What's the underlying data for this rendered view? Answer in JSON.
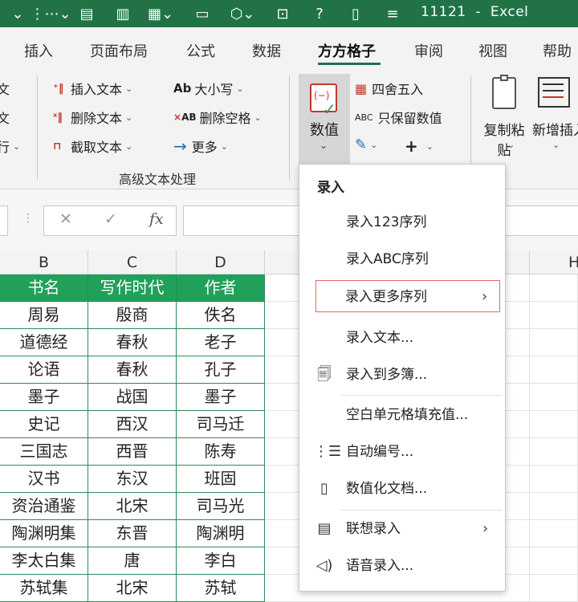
{
  "titlebar": {
    "doc_name": "11121",
    "separator": "-",
    "app_name": "Excel",
    "quick_access_icons": [
      "list-dropdown-icon",
      "form-icon",
      "chart-icon",
      "grid-icon",
      "screen-icon",
      "shapes-icon",
      "textbox-icon",
      "help-icon",
      "document-icon",
      "customize-icon"
    ]
  },
  "tabs": [
    {
      "label": "插入"
    },
    {
      "label": "页面布局"
    },
    {
      "label": "公式"
    },
    {
      "label": "数据"
    },
    {
      "label": "方方格子",
      "active": true
    },
    {
      "label": "审阅"
    },
    {
      "label": "视图"
    },
    {
      "label": "帮助"
    }
  ],
  "ribbon": {
    "left_partial": [
      "文",
      "文",
      "行"
    ],
    "text_group": {
      "insert_text": "插入文本",
      "delete_text": "删除文本",
      "extract_text": "截取文本",
      "case": "大小写",
      "case_icon": "Ab",
      "remove_spaces": "删除空格",
      "remove_spaces_icon": "AB",
      "more": "更多",
      "group_label": "高级文本处理"
    },
    "number_button": "数值",
    "round": "四舍五入",
    "keep_numbers": "只保留数值",
    "keep_numbers_icon": "ABC",
    "plus_label": "+",
    "copy_paste": "复制粘贴",
    "insert_new": "新增插入"
  },
  "formula_bar": {
    "cancel": "✕",
    "confirm": "✓",
    "fx": "fx"
  },
  "columns": [
    "B",
    "C",
    "D",
    "H"
  ],
  "table": {
    "headers": [
      "书名",
      "写作时代",
      "作者"
    ],
    "rows": [
      [
        "周易",
        "殷商",
        "佚名"
      ],
      [
        "道德经",
        "春秋",
        "老子"
      ],
      [
        "论语",
        "春秋",
        "孔子"
      ],
      [
        "墨子",
        "战国",
        "墨子"
      ],
      [
        "史记",
        "西汉",
        "司马迁"
      ],
      [
        "三国志",
        "西晋",
        "陈寿"
      ],
      [
        "汉书",
        "东汉",
        "班固"
      ],
      [
        "资治通鉴",
        "北宋",
        "司马光"
      ],
      [
        "陶渊明集",
        "东晋",
        "陶渊明"
      ],
      [
        "李太白集",
        "唐",
        "李白"
      ],
      [
        "苏轼集",
        "北宋",
        "苏轼"
      ]
    ]
  },
  "menu": {
    "header": "录入",
    "items": [
      {
        "label": "录入123序列",
        "icon": ""
      },
      {
        "label": "录入ABC序列",
        "icon": ""
      },
      {
        "label": "录入更多序列",
        "icon": "",
        "submenu": true,
        "highlighted": true
      },
      {
        "label": "录入文本...",
        "icon": ""
      },
      {
        "label": "录入到多簿...",
        "icon": "workbook-icon"
      },
      {
        "label": "空白单元格填充值...",
        "icon": ""
      },
      {
        "label": "自动编号...",
        "icon": "numbering-icon"
      },
      {
        "label": "数值化文档...",
        "icon": "document-icon"
      },
      {
        "label": "联想录入",
        "icon": "suggest-icon",
        "submenu": true
      },
      {
        "label": "语音录入...",
        "icon": "speaker-icon"
      }
    ]
  },
  "colors": {
    "excel_green": "#217346",
    "header_fill": "#21a05a",
    "highlight_border": "#e06a6a"
  }
}
